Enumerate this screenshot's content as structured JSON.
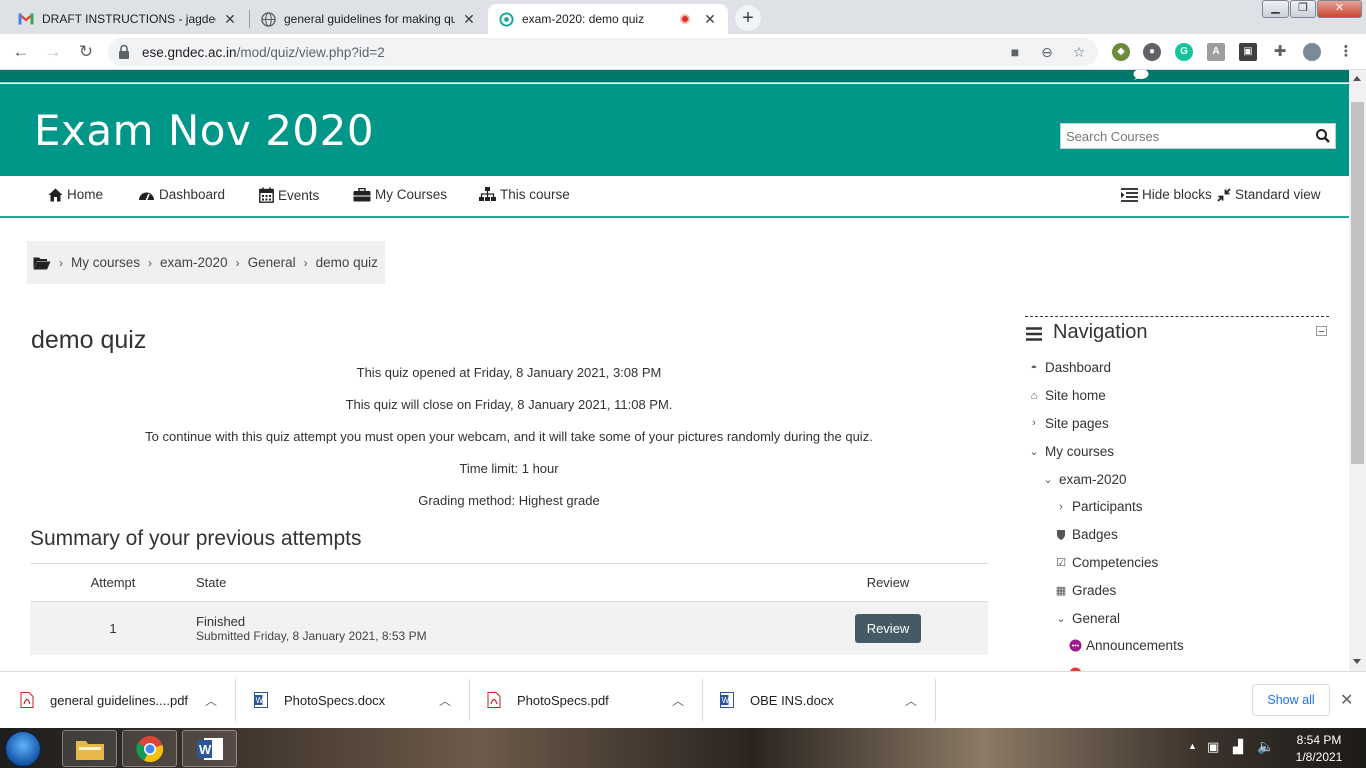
{
  "browser": {
    "tabs": [
      {
        "title": "DRAFT INSTRUCTIONS - jagdeep",
        "favicon": "gmail-icon"
      },
      {
        "title": "general guidelines for making qu",
        "favicon": "globe-icon"
      },
      {
        "title": "exam-2020: demo quiz",
        "favicon": "moodle-icon",
        "active": true
      }
    ],
    "url": {
      "domain": "ese.gndec.ac.in",
      "path": "/mod/quiz/view.php?id=2"
    }
  },
  "site": {
    "title": "Exam Nov 2020",
    "search_placeholder": "Search Courses"
  },
  "navbar": {
    "items": [
      "Home",
      "Dashboard",
      "Events",
      "My Courses",
      "This course"
    ],
    "hide_blocks": "Hide blocks",
    "standard_view": "Standard view"
  },
  "breadcrumb": [
    "My courses",
    "exam-2020",
    "General",
    "demo quiz"
  ],
  "quiz": {
    "title": "demo quiz",
    "opened": "This quiz opened at Friday, 8 January 2021, 3:08 PM",
    "closes": "This quiz will close on Friday, 8 January 2021, 11:08 PM.",
    "webcam": "To continue with this quiz attempt you must open your webcam, and it will take some of your pictures randomly during the quiz.",
    "time_limit": "Time limit: 1 hour",
    "grading": "Grading method: Highest grade",
    "summary_title": "Summary of your previous attempts",
    "table_headers": [
      "Attempt",
      "State",
      "Review"
    ],
    "attempts": [
      {
        "attempt": "1",
        "state": "Finished",
        "submitted": "Submitted Friday, 8 January 2021, 8:53 PM",
        "review": "Review"
      }
    ]
  },
  "sidebar": {
    "title": "Navigation",
    "items": [
      {
        "label": "Dashboard",
        "icon": "dashboard-icon",
        "indent": 0
      },
      {
        "label": "Site home",
        "icon": "home-icon",
        "indent": 0
      },
      {
        "label": "Site pages",
        "icon": "chevron-right-icon",
        "indent": 0
      },
      {
        "label": "My courses",
        "icon": "chevron-down-icon",
        "indent": 0
      },
      {
        "label": "exam-2020",
        "icon": "chevron-down-icon",
        "indent": 1
      },
      {
        "label": "Participants",
        "icon": "chevron-right-icon",
        "indent": 2
      },
      {
        "label": "Badges",
        "icon": "shield-icon",
        "indent": 2
      },
      {
        "label": "Competencies",
        "icon": "checkbox-icon",
        "indent": 2
      },
      {
        "label": "Grades",
        "icon": "table-icon",
        "indent": 2
      },
      {
        "label": "General",
        "icon": "chevron-down-icon",
        "indent": 2
      },
      {
        "label": "Announcements",
        "icon": "forum-icon",
        "indent": 3
      }
    ]
  },
  "downloads": {
    "items": [
      {
        "name": "general guidelines....pdf",
        "type": "pdf"
      },
      {
        "name": "PhotoSpecs.docx",
        "type": "docx"
      },
      {
        "name": "PhotoSpecs.pdf",
        "type": "pdf"
      },
      {
        "name": "OBE INS.docx",
        "type": "docx"
      }
    ],
    "show_all": "Show all"
  },
  "taskbar": {
    "time": "8:54 PM",
    "date": "1/8/2021"
  },
  "colors": {
    "header": "#009688",
    "review_button": "#455a64"
  }
}
